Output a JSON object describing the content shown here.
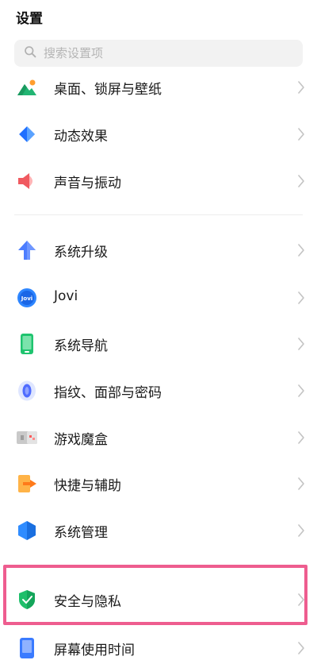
{
  "header": {
    "title": "设置"
  },
  "search": {
    "placeholder": "搜索设置项",
    "icon": "search-icon"
  },
  "items": [
    {
      "label": "桌面、锁屏与壁纸",
      "icon": "wallpaper-icon"
    },
    {
      "label": "动态效果",
      "icon": "dynamic-effects-icon"
    },
    {
      "label": "声音与振动",
      "icon": "sound-vibration-icon"
    },
    {
      "label": "系统升级",
      "icon": "system-update-icon"
    },
    {
      "label": "Jovi",
      "icon": "jovi-icon"
    },
    {
      "label": "系统导航",
      "icon": "system-navigation-icon"
    },
    {
      "label": "指纹、面部与密码",
      "icon": "fingerprint-icon"
    },
    {
      "label": "游戏魔盒",
      "icon": "game-box-icon"
    },
    {
      "label": "快捷与辅助",
      "icon": "shortcuts-accessibility-icon"
    },
    {
      "label": "系统管理",
      "icon": "system-management-icon"
    },
    {
      "label": "安全与隐私",
      "icon": "security-privacy-icon"
    },
    {
      "label": "屏幕使用时间",
      "icon": "screen-time-icon"
    }
  ],
  "colors": {
    "highlight": "#ee5d8f",
    "accent_blue": "#3a7bff"
  }
}
